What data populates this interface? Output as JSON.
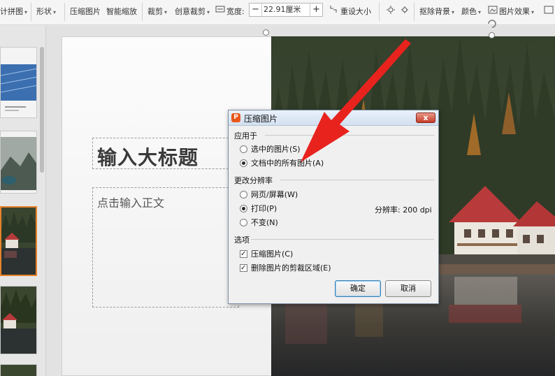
{
  "toolbar": {
    "puzzle_label": "计拼图",
    "shape_label": "形状",
    "compress_label": "压缩图片",
    "smart_zoom_label": "智能缩放",
    "crop_label": "裁剪",
    "creative_crop_label": "创意裁剪",
    "width_label": "宽度:",
    "width_value": "22.91厘米",
    "width_minus": "−",
    "width_plus": "+",
    "reset_size_label": "重设大小",
    "remove_bg_label": "抠除背景",
    "color_label": "颜色",
    "picture_effect_label": "图片效果"
  },
  "slide": {
    "title_placeholder": "输入大标题",
    "body_placeholder": "点击输入正文"
  },
  "dialog": {
    "title": "压缩图片",
    "close_glyph": "x",
    "apply_to": {
      "label": "应用于",
      "options": [
        "选中的图片(S)",
        "文档中的所有图片(A)"
      ],
      "selected": 1
    },
    "resolution": {
      "label": "更改分辨率",
      "options": [
        "网页/屏幕(W)",
        "打印(P)",
        "不变(N)"
      ],
      "selected": 1,
      "dpi_text": "分辨率: 200 dpi"
    },
    "options": {
      "label": "选项",
      "items": [
        {
          "label": "压缩图片(C)",
          "checked": true
        },
        {
          "label": "删除图片的剪裁区域(E)",
          "checked": true
        }
      ]
    },
    "ok_label": "确定",
    "cancel_label": "取消"
  },
  "colors": {
    "accent_orange": "#e8822a",
    "arrow_red": "#e8231e",
    "dialog_border": "#7d8fa6"
  }
}
